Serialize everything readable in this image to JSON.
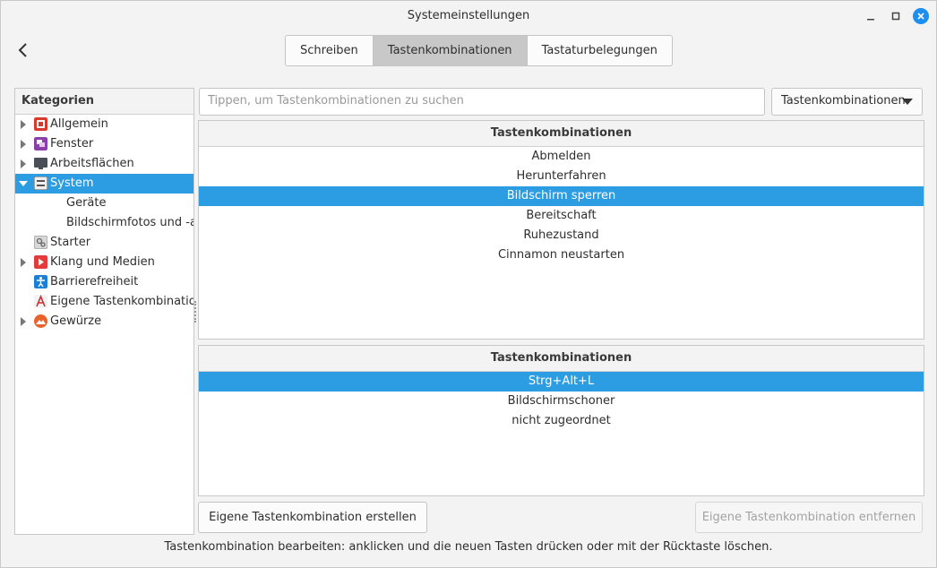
{
  "window": {
    "title": "Systemeinstellungen"
  },
  "tabs": [
    {
      "label": "Schreiben",
      "active": false
    },
    {
      "label": "Tastenkombinationen",
      "active": true
    },
    {
      "label": "Tastaturbelegungen",
      "active": false
    }
  ],
  "categories": {
    "header": "Kategorien",
    "items": [
      {
        "label": "Allgemein",
        "icon": "general-icon",
        "expander": "collapsed",
        "selected": false
      },
      {
        "label": "Fenster",
        "icon": "windows-icon",
        "expander": "collapsed",
        "selected": false
      },
      {
        "label": "Arbeitsflächen",
        "icon": "workspaces-icon",
        "expander": "collapsed",
        "selected": false
      },
      {
        "label": "System",
        "icon": "system-icon",
        "expander": "expanded",
        "selected": true
      },
      {
        "label": "Geräte",
        "icon": "",
        "expander": "none",
        "selected": false
      },
      {
        "label": "Bildschirmfotos und -au",
        "icon": "",
        "expander": "none",
        "selected": false
      },
      {
        "label": "Starter",
        "icon": "launcher-icon",
        "expander": "none",
        "selected": false
      },
      {
        "label": "Klang und Medien",
        "icon": "media-icon",
        "expander": "collapsed",
        "selected": false
      },
      {
        "label": "Barrierefreiheit",
        "icon": "accessibility-icon",
        "expander": "none",
        "selected": false
      },
      {
        "label": "Eigene Tastenkombination",
        "icon": "custom-shortcut-icon",
        "expander": "none",
        "selected": false
      },
      {
        "label": "Gewürze",
        "icon": "spices-icon",
        "expander": "collapsed",
        "selected": false
      }
    ]
  },
  "search": {
    "placeholder": "Tippen, um Tastenkombinationen zu suchen",
    "value": ""
  },
  "filter_dropdown": {
    "selected": "Tastenkombinationen"
  },
  "shortcut_list": {
    "header": "Tastenkombinationen",
    "rows": [
      {
        "label": "Abmelden",
        "selected": false
      },
      {
        "label": "Herunterfahren",
        "selected": false
      },
      {
        "label": "Bildschirm sperren",
        "selected": true
      },
      {
        "label": "Bereitschaft",
        "selected": false
      },
      {
        "label": "Ruhezustand",
        "selected": false
      },
      {
        "label": "Cinnamon neustarten",
        "selected": false
      }
    ]
  },
  "binding_list": {
    "header": "Tastenkombinationen",
    "rows": [
      {
        "label": "Strg+Alt+L",
        "selected": true
      },
      {
        "label": "Bildschirmschoner",
        "selected": false
      },
      {
        "label": "nicht zugeordnet",
        "selected": false
      }
    ]
  },
  "buttons": {
    "create": "Eigene Tastenkombination erstellen",
    "remove": "Eigene Tastenkombination entfernen"
  },
  "hint": "Tastenkombination bearbeiten: anklicken und die neuen Tasten drücken oder mit der Rücktaste löschen.",
  "colors": {
    "selection": "#2d9de3",
    "close_button": "#1d8ff0"
  }
}
